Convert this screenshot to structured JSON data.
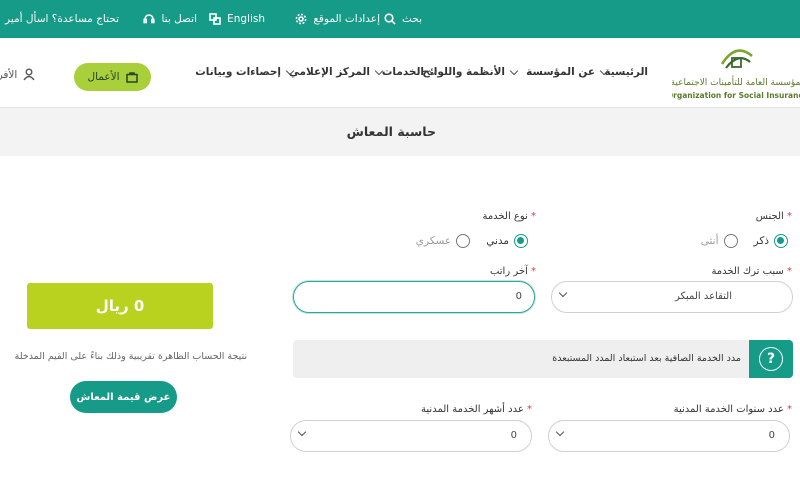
{
  "topbar": {
    "help_text": "تحتاج مساعدة؟ اسأل أمير",
    "contact": "اتصل بنا",
    "language": "English",
    "settings": "إعدادات الموقع",
    "search": "بحث",
    "color": "#159b88"
  },
  "logo": {
    "arabic": "المؤسسة العامة للتأمينات الاجتماعية",
    "english": "General Organization for Social Insurance"
  },
  "nav": {
    "items": [
      "الرئيسية",
      "عن المؤسسة",
      "الأنظمة واللوائح",
      "الخدمات",
      "المركز الإعلامي",
      "إحصاءات وبيانات"
    ],
    "business_button": "الأعمال",
    "login": "الأفراد"
  },
  "page": {
    "title": "حاسبة المعاش"
  },
  "form": {
    "gender": {
      "label": "الجنس",
      "options": [
        "ذكر",
        "أنثى"
      ],
      "selected": "ذكر"
    },
    "service_type": {
      "label": "نوع الخدمة",
      "options": [
        "مدني",
        "عسكري"
      ],
      "selected": "مدني"
    },
    "reason": {
      "label": "سبب ترك الخدمة",
      "value": "التقاعد المبكر"
    },
    "last_salary": {
      "label": "آخر راتب",
      "value": "0"
    },
    "info": "مدد الخدمة الصافية بعد استبعاد المدد المستبعدة",
    "info_icon": "?",
    "years": {
      "label": "عدد سنوات الخدمة المدنية",
      "value": "0"
    },
    "months": {
      "label": "عدد أشهر الخدمة المدنية",
      "value": "0"
    },
    "required_mark": "*"
  },
  "result": {
    "amount": "0 ريال",
    "note": "نتيجة الحساب الظاهرة تقريبية وذلك بناءً على القيم المدخلة",
    "button": "عرض قيمة المعاش",
    "color": "#b9d21f"
  }
}
